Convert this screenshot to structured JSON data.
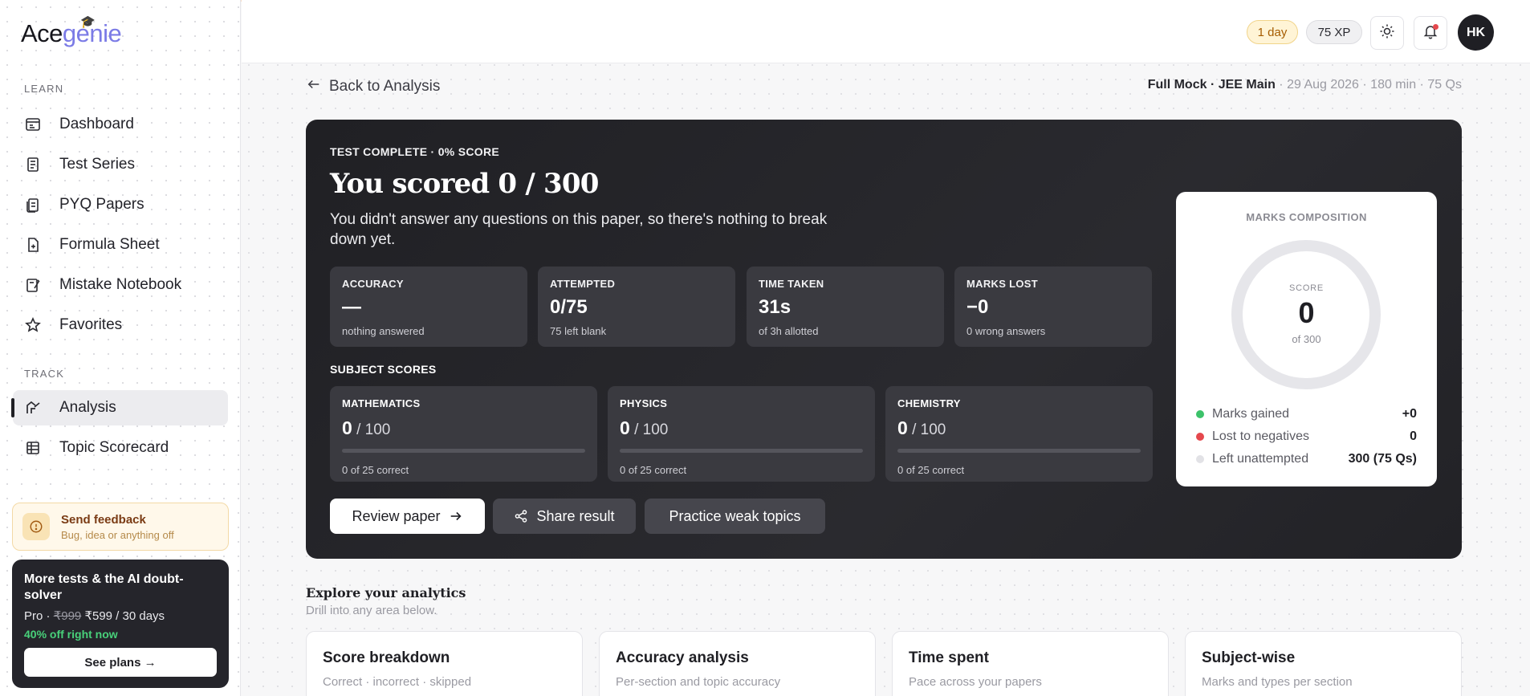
{
  "brand": {
    "name_part1": "Ace",
    "name_part2": "genie"
  },
  "sidebar": {
    "learn_label": "LEARN",
    "learn_items": [
      {
        "label": "Dashboard",
        "icon": "dashboard-icon"
      },
      {
        "label": "Test Series",
        "icon": "test-series-icon"
      },
      {
        "label": "PYQ Papers",
        "icon": "papers-icon"
      },
      {
        "label": "Formula Sheet",
        "icon": "formula-icon"
      },
      {
        "label": "Mistake Notebook",
        "icon": "notebook-icon"
      },
      {
        "label": "Favorites",
        "icon": "star-icon"
      }
    ],
    "track_label": "TRACK",
    "track_items": [
      {
        "label": "Analysis",
        "icon": "analysis-icon",
        "active": true
      },
      {
        "label": "Topic Scorecard",
        "icon": "scorecard-icon"
      }
    ],
    "feedback": {
      "title": "Send feedback",
      "subtitle": "Bug, idea or anything off"
    },
    "promo": {
      "title": "More tests & the AI doubt-solver",
      "plan": "Pro ·",
      "old_price": "₹999",
      "new_price": "₹599 / 30 days",
      "discount": "40% off right now",
      "cta": "See plans →"
    }
  },
  "header": {
    "streak": "1 day",
    "xp": "75 XP",
    "avatar_initials": "HK",
    "colors": {
      "streak_bg": "#fff4d6",
      "notification_dot": "#e5484d"
    }
  },
  "back_link": "Back to Analysis",
  "test_meta": {
    "name": "Full Mock · JEE Main",
    "details": " · 29 Aug 2026 · 180 min · 75 Qs"
  },
  "hero": {
    "eyebrow": "TEST COMPLETE · 0% SCORE",
    "headline": "You scored 0 / 300",
    "description": "You didn't answer any questions on this paper, so there's nothing to break down yet.",
    "stats": [
      {
        "label": "ACCURACY",
        "value": "—",
        "sub": "nothing answered"
      },
      {
        "label": "ATTEMPTED",
        "value": "0/75",
        "sub": "75 left blank"
      },
      {
        "label": "TIME TAKEN",
        "value": "31s",
        "sub": "of 3h allotted"
      },
      {
        "label": "MARKS LOST",
        "value": "−0",
        "sub": "0 wrong answers"
      }
    ],
    "subjects_heading": "SUBJECT SCORES",
    "subjects": [
      {
        "label": "MATHEMATICS",
        "score": "0",
        "of": " / 100",
        "progress": 0,
        "sub": "0 of 25 correct"
      },
      {
        "label": "PHYSICS",
        "score": "0",
        "of": " / 100",
        "progress": 0,
        "sub": "0 of 25 correct"
      },
      {
        "label": "CHEMISTRY",
        "score": "0",
        "of": " / 100",
        "progress": 0,
        "sub": "0 of 25 correct"
      }
    ],
    "actions": {
      "review": "Review paper",
      "share": "Share result",
      "practice": "Practice weak topics"
    }
  },
  "composition": {
    "title": "MARKS COMPOSITION",
    "score_label": "SCORE",
    "score": "0",
    "of": "of 300",
    "fraction_gained": 0,
    "legend": [
      {
        "label": "Marks gained",
        "value": "+0",
        "color": "#3cc26a"
      },
      {
        "label": "Lost to negatives",
        "value": "0",
        "color": "#e5484d"
      },
      {
        "label": "Left unattempted",
        "value": "300 (75 Qs)",
        "color": "#e2e2e6"
      }
    ]
  },
  "explore": {
    "title": "Explore your analytics",
    "subtitle": "Drill into any area below.",
    "tiles": [
      {
        "title": "Score breakdown",
        "subtitle": "Correct · incorrect · skipped"
      },
      {
        "title": "Accuracy analysis",
        "subtitle": "Per-section and topic accuracy"
      },
      {
        "title": "Time spent",
        "subtitle": "Pace across your papers"
      },
      {
        "title": "Subject-wise",
        "subtitle": "Marks and types per section"
      }
    ]
  }
}
